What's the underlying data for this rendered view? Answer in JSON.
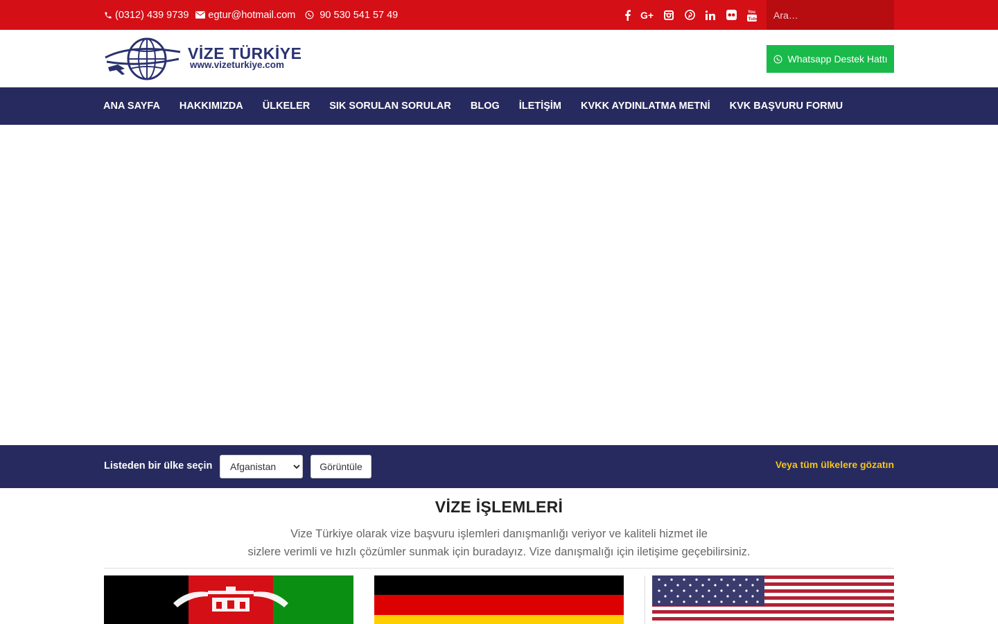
{
  "topbar": {
    "phone": "(0312) 439 9739",
    "email": "egtur@hotmail.com",
    "whatsapp": "90 530 541 57 49",
    "social": [
      "facebook-icon",
      "google-plus-icon",
      "instagram-icon",
      "pinterest-icon",
      "linkedin-icon",
      "flickr-icon",
      "youtube-icon"
    ],
    "search_placeholder": "Ara…"
  },
  "header": {
    "logo_brand": "VİZE TÜRKİYE",
    "logo_url": "www.vizeturkiye.com",
    "whatsapp_button": "Whatsapp Destek Hattı"
  },
  "nav": {
    "items": [
      "ANA SAYFA",
      "HAKKIMIZDA",
      "ÜLKELER",
      "SIK SORULAN SORULAR",
      "BLOG",
      "İLETİŞİM",
      "KVKK AYDINLATMA METNİ",
      "KVK BAŞVURU FORMU"
    ]
  },
  "country_bar": {
    "label": "Listeden bir ülke seçin",
    "selected": "Afganistan",
    "button": "Görüntüle",
    "all_link": "Veya tüm ülkelere gözatın"
  },
  "section": {
    "title": "VİZE İŞLEMLERİ",
    "desc_line1": "Vize Türkiye olarak vize başvuru işlemleri danışmanlığı veriyor ve kaliteli hizmet ile",
    "desc_line2": "sizlere verimli ve hızlı çözümler sunmak için buradayız. Vize danışmalığı için iletişime geçebilirsiniz."
  },
  "colors": {
    "topbar": "#d40f16",
    "nav": "#272a5e",
    "whatsapp": "#19b94a",
    "accent_link": "#f5c518"
  }
}
